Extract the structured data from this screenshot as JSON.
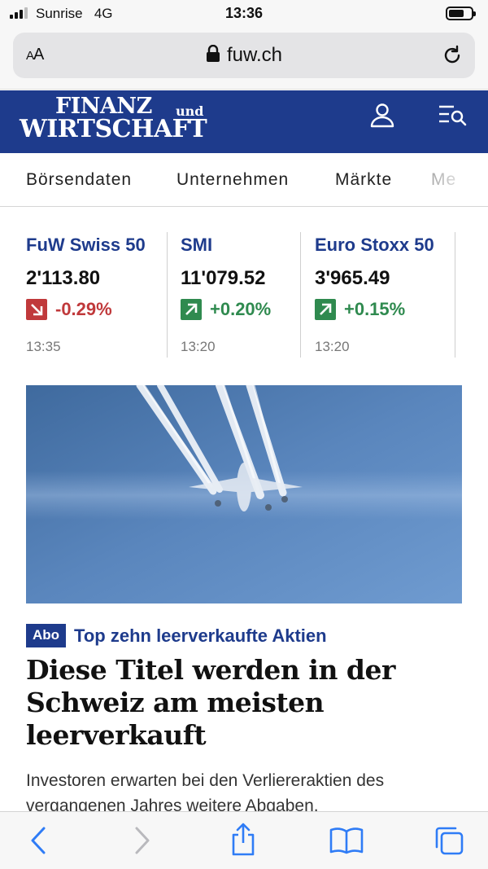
{
  "status_bar": {
    "carrier": "Sunrise",
    "network": "4G",
    "time": "13:36",
    "battery_level": 0.7
  },
  "browser": {
    "text_size_label_small": "A",
    "text_size_label_large": "A",
    "url": "fuw.ch"
  },
  "header": {
    "logo_line1": "FINANZ",
    "logo_und": "und",
    "logo_line2": "WIRTSCHAFT",
    "brand_color": "#1e3b8c",
    "icons": [
      "user-icon",
      "menu-search-icon"
    ]
  },
  "nav": {
    "items": [
      "Börsendaten",
      "Unternehmen",
      "Märkte",
      "Me"
    ]
  },
  "markets": [
    {
      "name": "FuW Swiss 50",
      "value": "2'113.80",
      "change": "-0.29%",
      "direction": "down",
      "time": "13:35",
      "color": "#c0393b"
    },
    {
      "name": "SMI",
      "value": "11'079.52",
      "change": "+0.20%",
      "direction": "up",
      "time": "13:20",
      "color": "#2f8a4f"
    },
    {
      "name": "Euro Stoxx 50",
      "value": "3'965.49",
      "change": "+0.15%",
      "direction": "up",
      "time": "13:20",
      "color": "#2f8a4f"
    }
  ],
  "article": {
    "badge": "Abo",
    "kicker": "Top zehn leerverkaufte Aktien",
    "headline": "Diese Titel werden in der Schweiz am meisten leerverkauft",
    "teaser": "Investoren erwarten bei den Verliereraktien des vergangenen Jahres weitere Abgaben."
  },
  "toolbar": {
    "icons": [
      "back-icon",
      "forward-icon",
      "share-icon",
      "bookmarks-icon",
      "tabs-icon"
    ]
  }
}
